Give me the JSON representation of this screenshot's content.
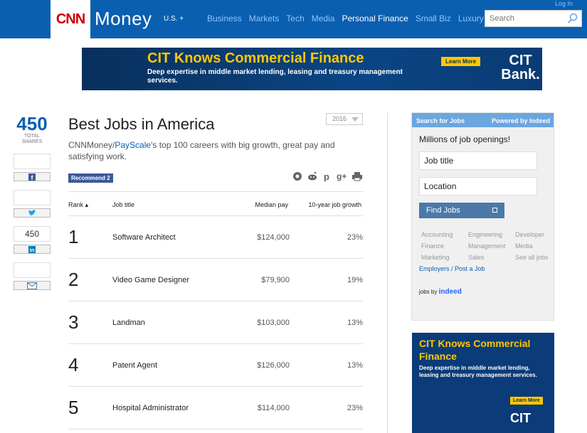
{
  "header": {
    "logo_cnn": "CNN",
    "logo_money": "Money",
    "edition": "U.S. +",
    "login": "Log In",
    "search_placeholder": "Search",
    "nav": [
      "Business",
      "Markets",
      "Tech",
      "Media",
      "Personal Finance",
      "Small Biz",
      "Luxury"
    ],
    "active_nav": "Personal Finance"
  },
  "ad_top": {
    "headline": "CIT Knows Commercial Finance",
    "subtext": "Deep expertise in middle market lending, leasing and treasury management services.",
    "button": "Learn More",
    "logo": "CIT Bank."
  },
  "share": {
    "total": "450",
    "label": "TOTAL SHARES",
    "twitter_count": "450"
  },
  "article": {
    "title": "Best Jobs in America",
    "year": "2016",
    "subtitle_prefix": "CNNMoney/",
    "subtitle_link": "PayScale",
    "subtitle_suffix": "'s top 100 careers with big growth, great pay and satisfying work.",
    "fb_recommend": "Recommend 2"
  },
  "table": {
    "headers": [
      "Rank",
      "Job title",
      "Median pay",
      "10-year job growth"
    ],
    "rows": [
      {
        "rank": "1",
        "job": "Software Architect",
        "pay": "$124,000",
        "growth": "23%"
      },
      {
        "rank": "2",
        "job": "Video Game Designer",
        "pay": "$79,900",
        "growth": "19%"
      },
      {
        "rank": "3",
        "job": "Landman",
        "pay": "$103,000",
        "growth": "13%"
      },
      {
        "rank": "4",
        "job": "Patent Agent",
        "pay": "$126,000",
        "growth": "13%"
      },
      {
        "rank": "5",
        "job": "Hospital Administrator",
        "pay": "$114,000",
        "growth": "23%"
      }
    ]
  },
  "jobs_widget": {
    "header_left": "Search for Jobs",
    "header_right": "Powered by Indeed",
    "intro": "Millions of job openings!",
    "job_title_placeholder": "Job title",
    "location_placeholder": "Location",
    "button": "Find Jobs",
    "categories": [
      "Accounting",
      "Engineering",
      "Developer",
      "Finance",
      "Management",
      "Media",
      "Marketing",
      "Sales",
      "See all jobs"
    ],
    "employers_link": "Employers / Post a Job",
    "powered_prefix": "jobs by",
    "powered_brand": "indeed"
  },
  "ad_side": {
    "headline": "CIT Knows Commercial Finance",
    "subtext": "Deep expertise in middle market lending, leasing and treasury management services.",
    "button": "Learn More",
    "logo": "CIT"
  }
}
